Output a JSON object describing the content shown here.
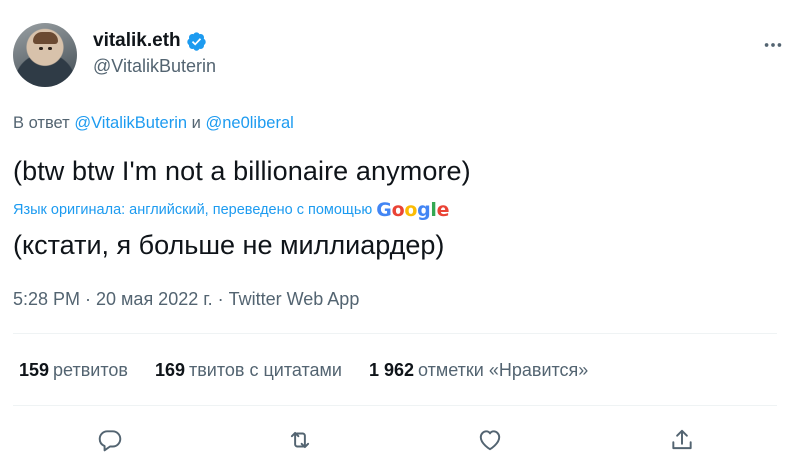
{
  "tweet": {
    "author": {
      "display_name": "vitalik.eth",
      "handle": "@VitalikButerin",
      "verified": true
    },
    "reply_to": {
      "prefix": "В ответ",
      "mention1": "@VitalikButerin",
      "conjunction": "и",
      "mention2": "@ne0liberal"
    },
    "text": "(btw btw I'm not a billionaire anymore)",
    "translation_note": "Язык оригинала: английский, переведено с помощью",
    "translation_provider": {
      "g1": "G",
      "o1": "o",
      "o2": "o",
      "g2": "g",
      "l": "l",
      "e": "e"
    },
    "translated_text": "(кстати, я больше не миллиардер)",
    "meta": "5:28 PM · 20 мая 2022 г. · Twitter Web App",
    "stats": {
      "retweets_count": "159",
      "retweets_label": "ретвитов",
      "quotes_count": "169",
      "quotes_label": "твитов с цитатами",
      "likes_count": "1 962",
      "likes_label": "отметки «Нравится»"
    },
    "actions": [
      "reply-icon",
      "retweet-icon",
      "like-icon",
      "share-icon"
    ],
    "colors": {
      "accent": "#1d9bf0",
      "text": "#0f1419",
      "secondary": "#536471"
    }
  }
}
